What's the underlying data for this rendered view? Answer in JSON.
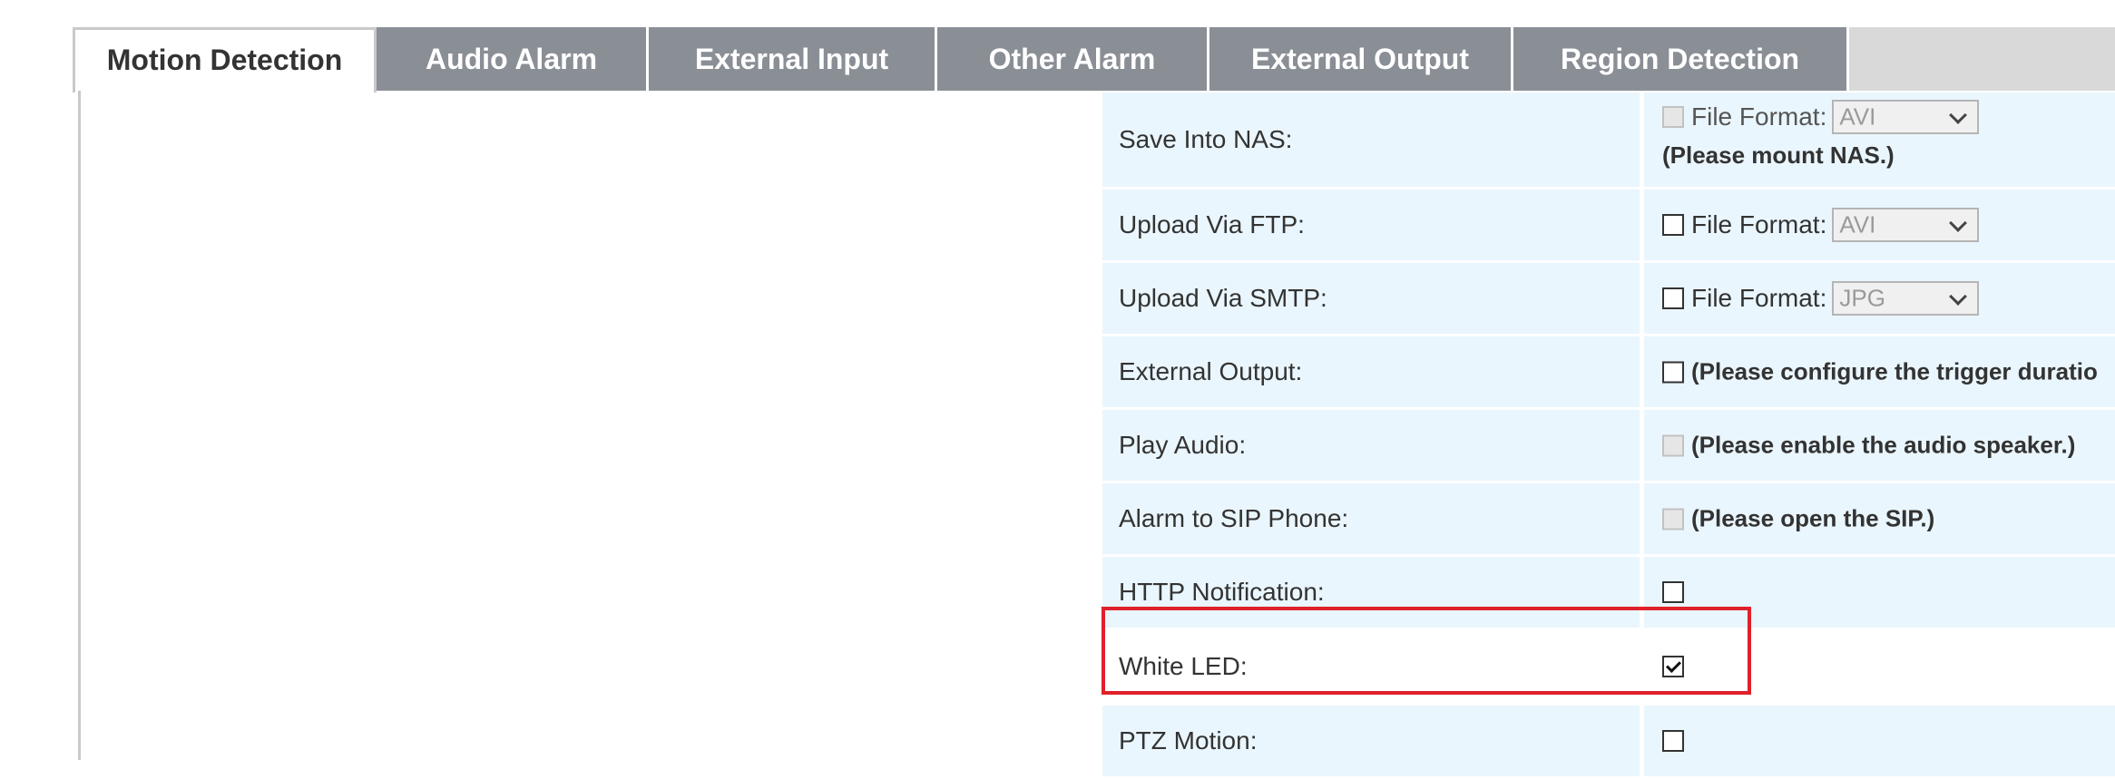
{
  "tabs": [
    {
      "label": "Motion Detection",
      "active": true
    },
    {
      "label": "Audio Alarm",
      "active": false
    },
    {
      "label": "External Input",
      "active": false
    },
    {
      "label": "Other Alarm",
      "active": false
    },
    {
      "label": "External Output",
      "active": false
    },
    {
      "label": "Region Detection",
      "active": false
    }
  ],
  "rows": {
    "save_nas": {
      "label": "Save Into NAS:",
      "checked": false,
      "disabled": true,
      "file_format_label": "File Format:",
      "file_format_value": "AVI",
      "note": "(Please mount NAS.)"
    },
    "upload_ftp": {
      "label": "Upload Via FTP:",
      "checked": false,
      "disabled": false,
      "file_format_label": "File Format:",
      "file_format_value": "AVI"
    },
    "upload_smtp": {
      "label": "Upload Via SMTP:",
      "checked": false,
      "disabled": false,
      "file_format_label": "File Format:",
      "file_format_value": "JPG"
    },
    "external_output": {
      "label": "External Output:",
      "checked": false,
      "disabled": false,
      "note": "(Please configure the trigger duratio"
    },
    "play_audio": {
      "label": "Play Audio:",
      "checked": false,
      "disabled": true,
      "note": "(Please enable the audio speaker.)"
    },
    "sip_phone": {
      "label": "Alarm to SIP Phone:",
      "checked": false,
      "disabled": true,
      "note": "(Please open the SIP.)"
    },
    "http_notification": {
      "label": "HTTP Notification:",
      "checked": false,
      "disabled": false
    },
    "white_led": {
      "label": "White LED:",
      "checked": true,
      "disabled": false
    },
    "ptz_motion": {
      "label": "PTZ Motion:",
      "checked": false,
      "disabled": false
    }
  },
  "colors": {
    "tab_inactive": "#8a8f96",
    "row_background": "#eaf6fd",
    "highlight_border": "#e0202a"
  }
}
